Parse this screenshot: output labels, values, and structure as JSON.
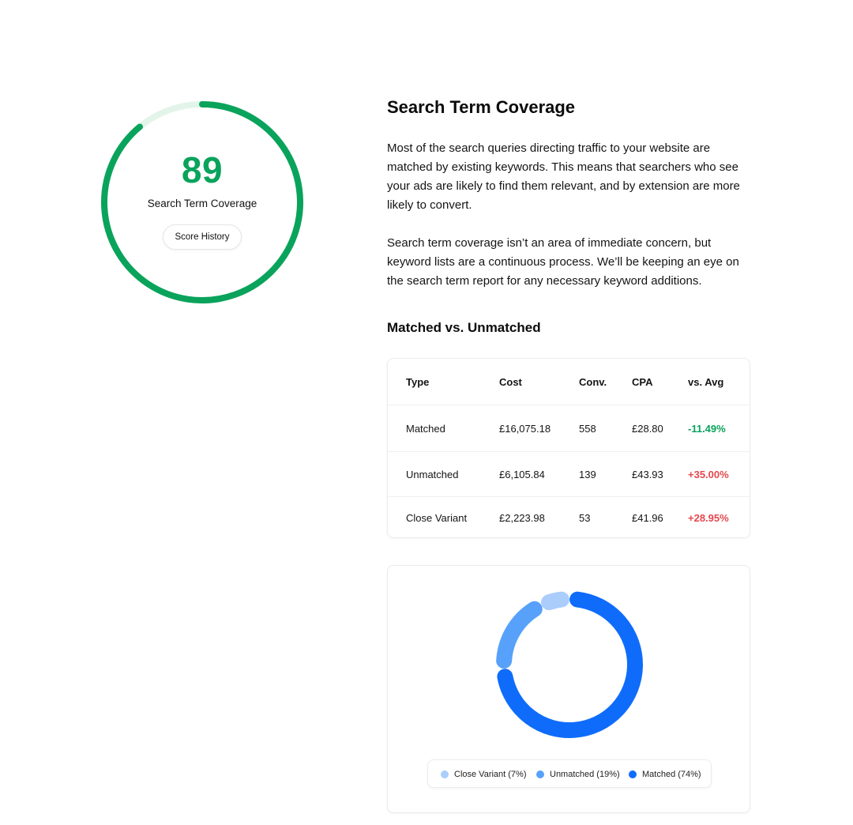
{
  "score_card": {
    "score": "89",
    "score_value": 89,
    "label": "Search Term Coverage",
    "history_button": "Score History",
    "accent_color": "#0aa35c",
    "track_color": "#e3f5ea"
  },
  "content": {
    "title": "Search Term Coverage",
    "paragraph_1": "Most of the search queries directing traffic to your website are matched by existing keywords. This means that searchers who see your ads are likely to find them relevant, and by extension are more likely to convert.",
    "paragraph_2": "Search term coverage isn’t an area of immediate concern, but keyword lists are a continuous process. We’ll be keeping an eye on the search term report for any necessary keyword additions.",
    "subtitle": "Matched vs. Unmatched"
  },
  "table": {
    "headers": [
      "Type",
      "Cost",
      "Conv.",
      "CPA",
      "vs. Avg"
    ],
    "rows": [
      [
        "Matched",
        "£16,075.18",
        "558",
        "£28.80",
        "-11.49%"
      ],
      [
        "Unmatched",
        "£6,105.84",
        "139",
        "£43.93",
        "+35.00%"
      ],
      [
        "Close Variant",
        "£2,223.98",
        "53",
        "£41.96",
        "+28.95%"
      ]
    ],
    "positive_color": "#0aa35c",
    "negative_color": "#e5484d"
  },
  "chart_data": {
    "type": "pie",
    "categories": [
      "Close Variant",
      "Unmatched",
      "Matched"
    ],
    "values": [
      7,
      19,
      74
    ],
    "colors": [
      "#aacdfb",
      "#57a1fb",
      "#0f6cfb"
    ],
    "legend": [
      "Close Variant (7%)",
      "Unmatched (19%)",
      "Matched (74%)"
    ],
    "legend_placement": "bottom"
  }
}
